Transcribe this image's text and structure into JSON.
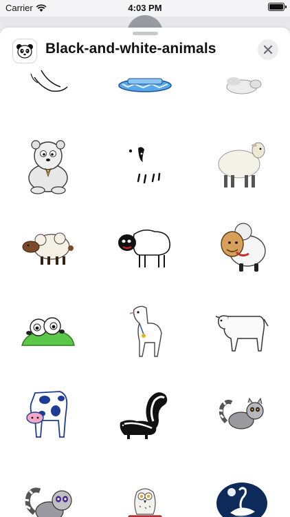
{
  "status_bar": {
    "carrier": "Carrier",
    "time": "4:03 PM",
    "wifi_icon": "wifi-icon",
    "battery_icon": "battery-icon"
  },
  "sheet": {
    "title": "Black-and-white-animals",
    "app_icon": "panda-icon",
    "close_icon": "close-icon"
  },
  "stickers": [
    {
      "name": "cut-off-hands-sticker"
    },
    {
      "name": "cut-off-blue-ice-sticker"
    },
    {
      "name": "cut-off-white-animal-sticker"
    },
    {
      "name": "polar-bear-sticker"
    },
    {
      "name": "hidden-sheep-sticker"
    },
    {
      "name": "white-sheep-sticker"
    },
    {
      "name": "brown-face-sheep-sticker"
    },
    {
      "name": "black-face-sheep-sticker"
    },
    {
      "name": "cartoon-ram-sticker"
    },
    {
      "name": "sheep-on-hill-sticker"
    },
    {
      "name": "white-goat-sticker"
    },
    {
      "name": "white-calf-sticker"
    },
    {
      "name": "spotted-cow-sticker"
    },
    {
      "name": "skunk-sticker"
    },
    {
      "name": "lemur-sticker"
    },
    {
      "name": "baby-lemur-sticker"
    },
    {
      "name": "snowy-owl-sticker"
    },
    {
      "name": "swan-moon-sticker"
    }
  ],
  "colors": {
    "ink": "#111111",
    "wool": "#f4f1e6",
    "sheep_brown": "#7a4a2a",
    "grass": "#5cc84a",
    "ice_blue": "#57a8e8",
    "cow_blue": "#1d3c96",
    "swan_night": "#0d2a5a"
  }
}
